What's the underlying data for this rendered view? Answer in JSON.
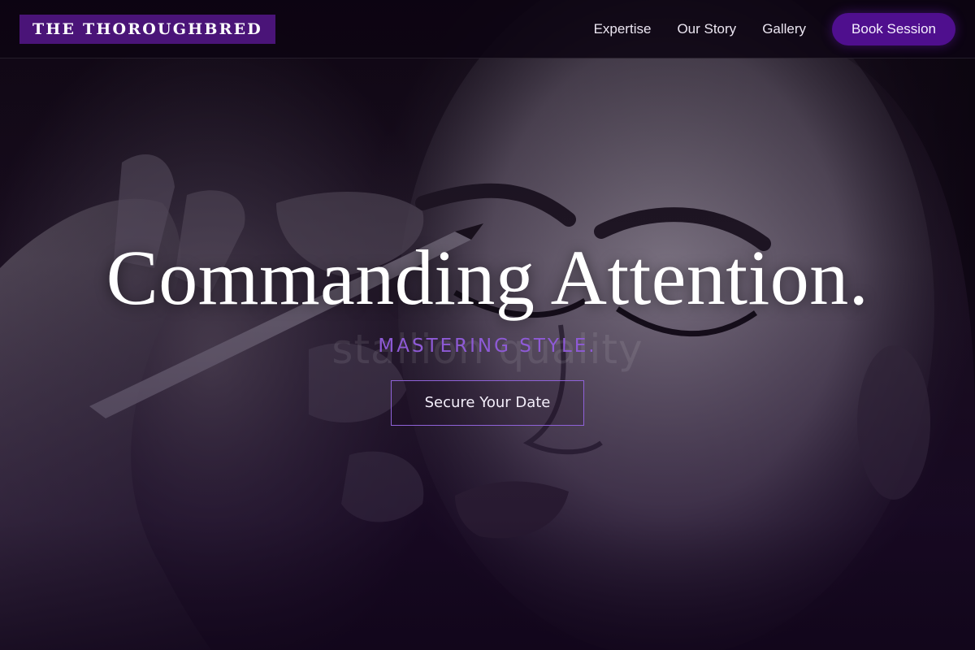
{
  "brand": {
    "logo_text": "THE THOROUGHBRED"
  },
  "nav": {
    "links": [
      {
        "label": "Expertise"
      },
      {
        "label": "Our Story"
      },
      {
        "label": "Gallery"
      }
    ],
    "cta_label": "Book Session"
  },
  "hero": {
    "headline": "Commanding Attention.",
    "ghost_text": "stallion quality",
    "tagline": "MASTERING STYLE.",
    "cta_label": "Secure Your Date",
    "background_image": "makeup-artist-applying-eyeliner-photo"
  },
  "colors": {
    "brand_purple": "#4a1478",
    "cta_purple": "#4f0f8e",
    "accent_violet": "#8e5ad6",
    "background": "#0b0410"
  }
}
